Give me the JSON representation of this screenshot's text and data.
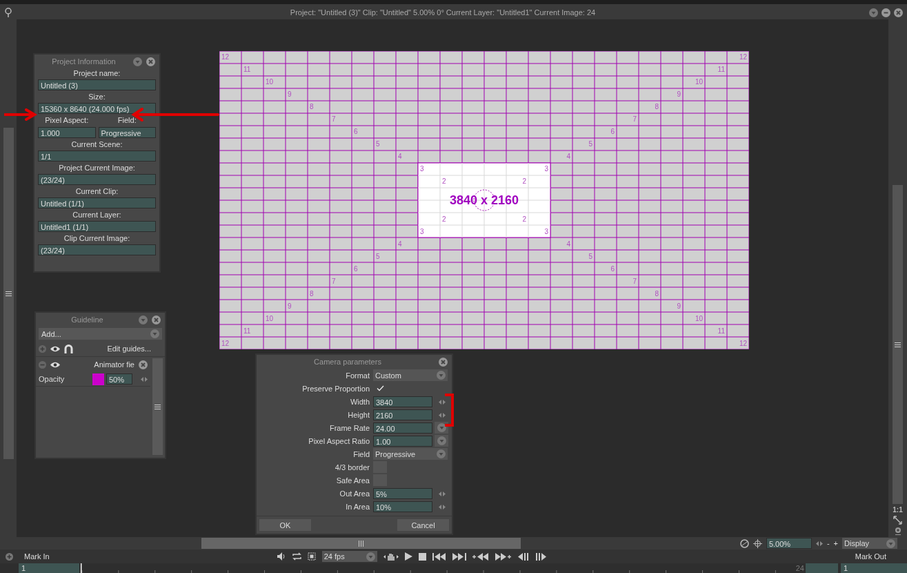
{
  "title_bar": {
    "text": "Project:  \"Untitled (3)\"  Clip: \"Untitled\"   5.00%   0°  Current Layer: \"Untitled1\"  Current Image: 24"
  },
  "project_information": {
    "title": "Project Information",
    "fields": [
      {
        "kind": "single",
        "label": "Project name:",
        "value": "Untitled (3)"
      },
      {
        "kind": "single",
        "label": "Size:",
        "value": "15360 x 8640 (24.000 fps)"
      },
      {
        "kind": "pair",
        "items": [
          {
            "label": "Pixel Aspect:",
            "value": "1.000"
          },
          {
            "label": "Field:",
            "value": "Progressive"
          }
        ]
      },
      {
        "kind": "single",
        "label": "Current Scene:",
        "value": "1/1"
      },
      {
        "kind": "single",
        "label": "Project Current Image:",
        "value": " (23/24)"
      },
      {
        "kind": "single",
        "label": "Current Clip:",
        "value": "Untitled (1/1)"
      },
      {
        "kind": "single",
        "label": "Current Layer:",
        "value": "Untitled1 (1/1)"
      },
      {
        "kind": "single",
        "label": "Clip Current Image:",
        "value": " (23/24)"
      }
    ]
  },
  "guideline": {
    "title": "Guideline",
    "add_dropdown": "Add...",
    "edit_button": "Edit guides...",
    "guides": [
      {
        "name": "Animator fie",
        "opacity_label": "Opacity",
        "color": "#cc00cc",
        "opacity": "50%"
      }
    ]
  },
  "canvas": {
    "size_label": "3840 x 2160",
    "marks": [
      [
        "12",
        "12",
        "12",
        "12"
      ],
      [
        "11",
        "11",
        "11",
        "11"
      ],
      [
        "10",
        "10",
        "10",
        "10"
      ],
      [
        "9",
        "9",
        "9",
        "9"
      ],
      [
        "8",
        "8",
        "8",
        "8"
      ],
      [
        "7",
        "7",
        "7",
        "7"
      ],
      [
        "6",
        "6",
        "6",
        "6"
      ],
      [
        "5",
        "5",
        "5",
        "5"
      ],
      [
        "4",
        "4",
        "4",
        "4"
      ],
      [
        "3",
        "3",
        "3",
        "3"
      ],
      [
        "2",
        "2",
        "2",
        "2"
      ]
    ]
  },
  "camera_parameters": {
    "title": "Camera parameters",
    "rows": [
      {
        "kind": "dropdown",
        "label": "Format",
        "value": "Custom"
      },
      {
        "kind": "checkbox",
        "label": "Preserve Proportion",
        "checked": true
      },
      {
        "kind": "spin",
        "label": "Width",
        "value": "3840"
      },
      {
        "kind": "spin",
        "label": "Height",
        "value": "2160"
      },
      {
        "kind": "combo",
        "label": "Frame Rate",
        "value": "24.00"
      },
      {
        "kind": "combo",
        "label": "Pixel Aspect Ratio",
        "value": "1.00"
      },
      {
        "kind": "dropdown",
        "label": "Field",
        "value": "Progressive"
      },
      {
        "kind": "checkbox",
        "label": "4/3 border",
        "checked": false
      },
      {
        "kind": "checkbox",
        "label": "Safe Area",
        "checked": false
      },
      {
        "kind": "spin",
        "label": "Out Area",
        "value": "5%"
      },
      {
        "kind": "spin",
        "label": "In Area",
        "value": "10%"
      }
    ],
    "buttons": [
      "OK",
      "Cancel"
    ]
  },
  "right_toolbar": {
    "actual_size_button": "1:1"
  },
  "zoom_bar": {
    "zoom": "5.00%",
    "zoom_out": "-",
    "zoom_in": "+",
    "display": "Display"
  },
  "transport": {
    "mark_in": "Mark In",
    "fps": "24 fps",
    "mark_out": "Mark Out"
  },
  "timeline": {
    "start": "1",
    "end_frame": "24",
    "end": "1"
  }
}
